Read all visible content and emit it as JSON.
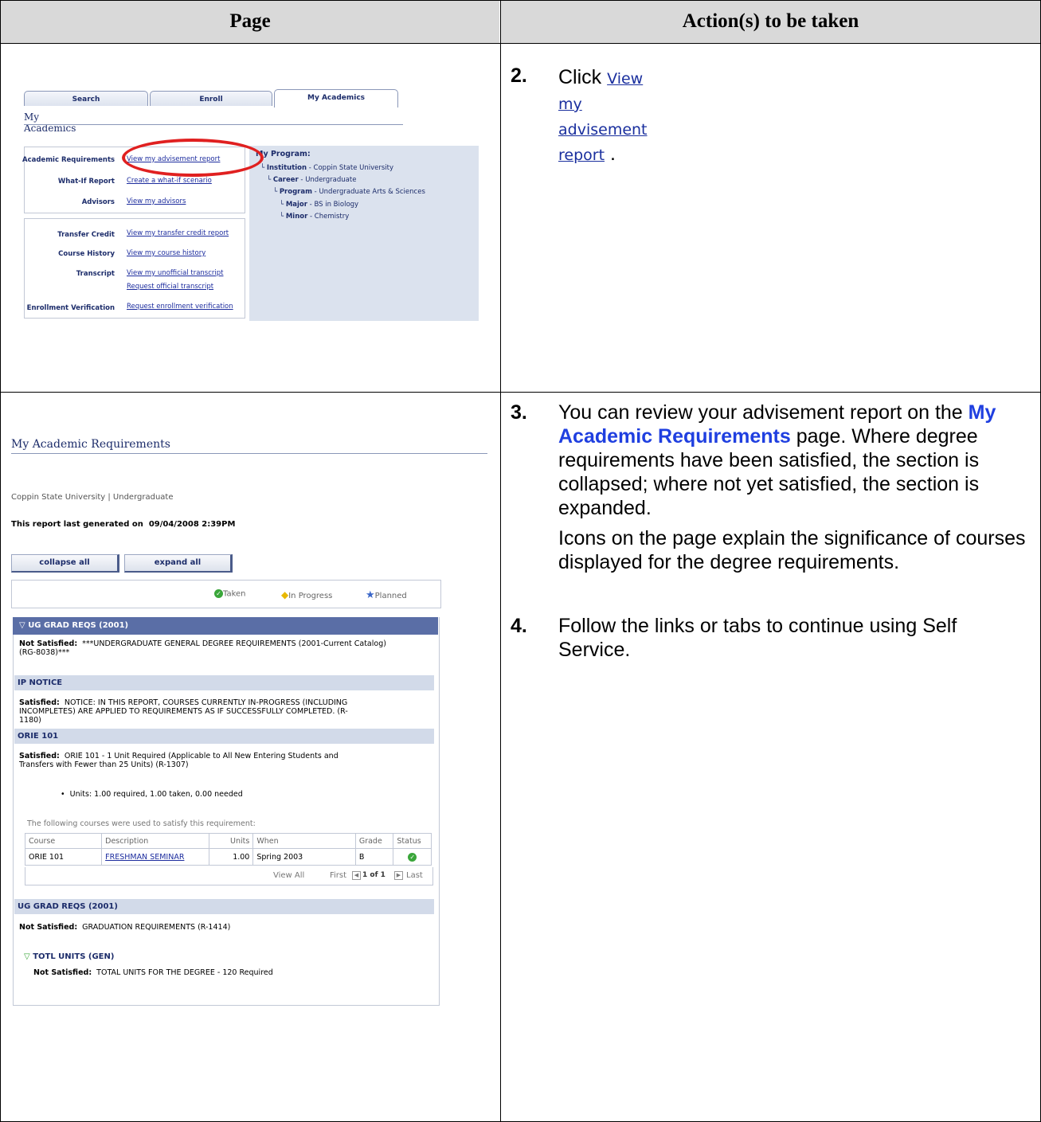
{
  "header": {
    "page": "Page",
    "actions": "Action(s) to be taken"
  },
  "steps": [
    {
      "num": "2.",
      "pre": "Click",
      "link": "View my advisement report",
      "post": "."
    },
    {
      "num": "3.",
      "pre": "You can review your advisement report on the",
      "hl": "My Academic Requirements",
      "post": "page. Where degree requirements have been satisfied, the section is collapsed; where not yet satisfied, the section is expanded.",
      "para2": "Icons on the page explain the significance of courses displayed for the degree requirements."
    },
    {
      "num": "4.",
      "text": "Follow the links or tabs to continue using Self Service."
    }
  ],
  "shot1": {
    "tabs": [
      "Search",
      "Enroll",
      "My Academics"
    ],
    "title": "My Academics",
    "rows": [
      {
        "label": "Academic Requirements",
        "links": [
          "View my advisement report"
        ]
      },
      {
        "label": "What-If Report",
        "links": [
          "Create a what-if scenario"
        ]
      },
      {
        "label": "Advisors",
        "links": [
          "View my advisors"
        ]
      },
      {
        "label": "Transfer Credit",
        "links": [
          "View my transfer credit report"
        ]
      },
      {
        "label": "Course History",
        "links": [
          "View my course history"
        ]
      },
      {
        "label": "Transcript",
        "links": [
          "View my unofficial transcript",
          "Request official transcript"
        ]
      },
      {
        "label": "Enrollment Verification",
        "links": [
          "Request enrollment verification"
        ]
      }
    ],
    "program": {
      "heading": "My Program:",
      "institution_label": "Institution",
      "institution": "Coppin State University",
      "career_label": "Career",
      "career": "Undergraduate",
      "program_label": "Program",
      "program": "Undergraduate Arts & Sciences",
      "major_label": "Major",
      "major": "BS in Biology",
      "minor_label": "Minor",
      "minor": "Chemistry"
    }
  },
  "shot2": {
    "title": "My Academic Requirements",
    "subtitle": "Coppin State University | Undergraduate",
    "generated_label": "This report last generated on",
    "generated_value": "09/04/2008  2:39PM",
    "collapse_btn": "collapse all",
    "expand_btn": "expand all",
    "legend": {
      "taken": "Taken",
      "in_progress": "In Progress",
      "planned": "Planned"
    },
    "report_head": "UG GRAD REQS (2001)",
    "req1_status": "Not Satisfied:",
    "req1_l1": "***UNDERGRADUATE GENERAL DEGREE REQUIREMENTS (2001-Current Catalog)",
    "req1_l2": "(RG-8038)***",
    "sect_ip": "IP NOTICE",
    "ip_status": "Satisfied:",
    "ip_l1": "NOTICE: IN THIS REPORT, COURSES CURRENTLY IN-PROGRESS (INCLUDING",
    "ip_l2": "INCOMPLETES) ARE APPLIED TO REQUIREMENTS AS IF SUCCESSFULLY COMPLETED. (R-",
    "ip_l3": "1180)",
    "sect_orie": "ORIE 101",
    "orie_status": "Satisfied:",
    "orie_l1": "ORIE 101 - 1 Unit Required (Applicable to All New Entering Students and",
    "orie_l2": "Transfers with Fewer than 25 Units) (R-1307)",
    "units_line": "Units: 1.00 required, 1.00 taken, 0.00 needed",
    "used_line": "The following courses were used to satisfy this requirement:",
    "table": {
      "headers": [
        "Course",
        "Description",
        "Units",
        "When",
        "Grade",
        "Status"
      ],
      "row": {
        "course": "ORIE 101",
        "desc": "FRESHMAN SEMINAR",
        "units": "1.00",
        "when": "Spring 2003",
        "grade": "B"
      }
    },
    "nav": {
      "view_all": "View All",
      "first": "First",
      "pos": "1 of 1",
      "last": "Last"
    },
    "sect_ug2": "UG GRAD REQS (2001)",
    "ug2_status": "Not Satisfied:",
    "ug2_text": "GRADUATION REQUIREMENTS (R-1414)",
    "totl_head": "TOTL UNITS (GEN)",
    "totl_status": "Not Satisfied:",
    "totl_text": "TOTAL UNITS FOR THE DEGREE - 120 Required"
  }
}
